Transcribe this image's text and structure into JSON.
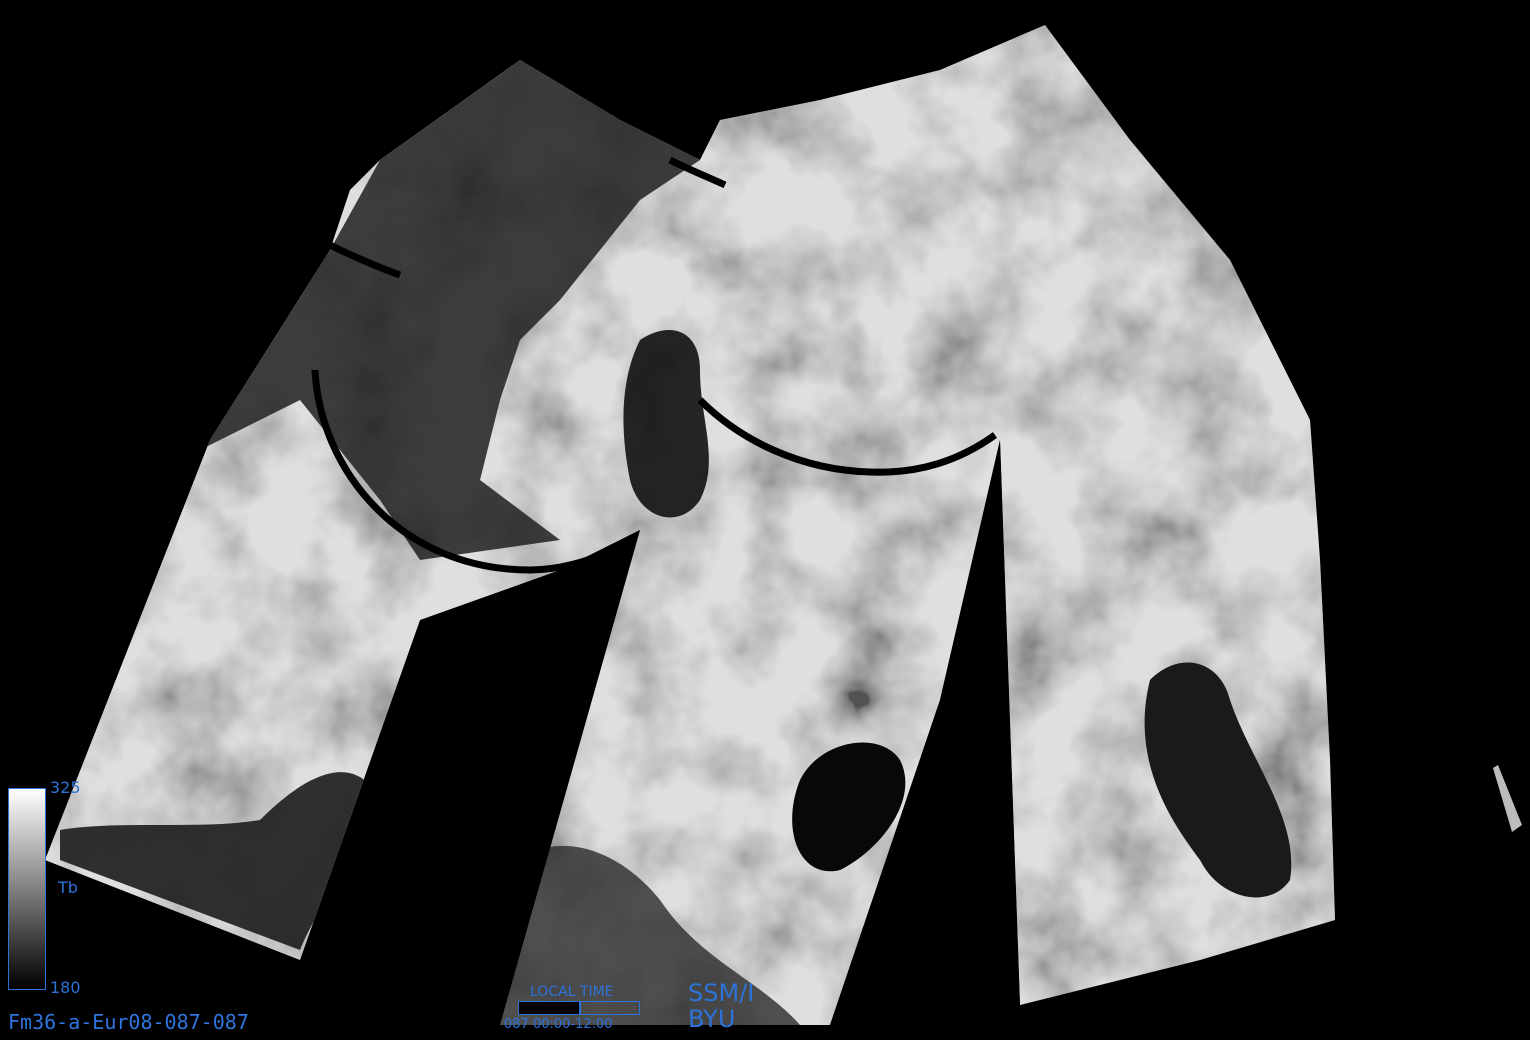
{
  "product": {
    "filename": "Fm36-a-Eur08-087-087",
    "sensor": "SSM/I",
    "institution": "BYU"
  },
  "colorbar": {
    "max_label": "325",
    "min_label": "180",
    "variable": "Tb",
    "min_color": "#000000",
    "max_color": "#ffffff"
  },
  "local_time": {
    "title": "LOCAL  TIME",
    "range_label": "087  00:00-12:00",
    "fill_fraction": 0.5
  },
  "colors": {
    "background": "#000000",
    "annotation": "#2c72d8",
    "swath_bright": "#c8c8c8",
    "swath_dark": "#2a2a2a"
  }
}
